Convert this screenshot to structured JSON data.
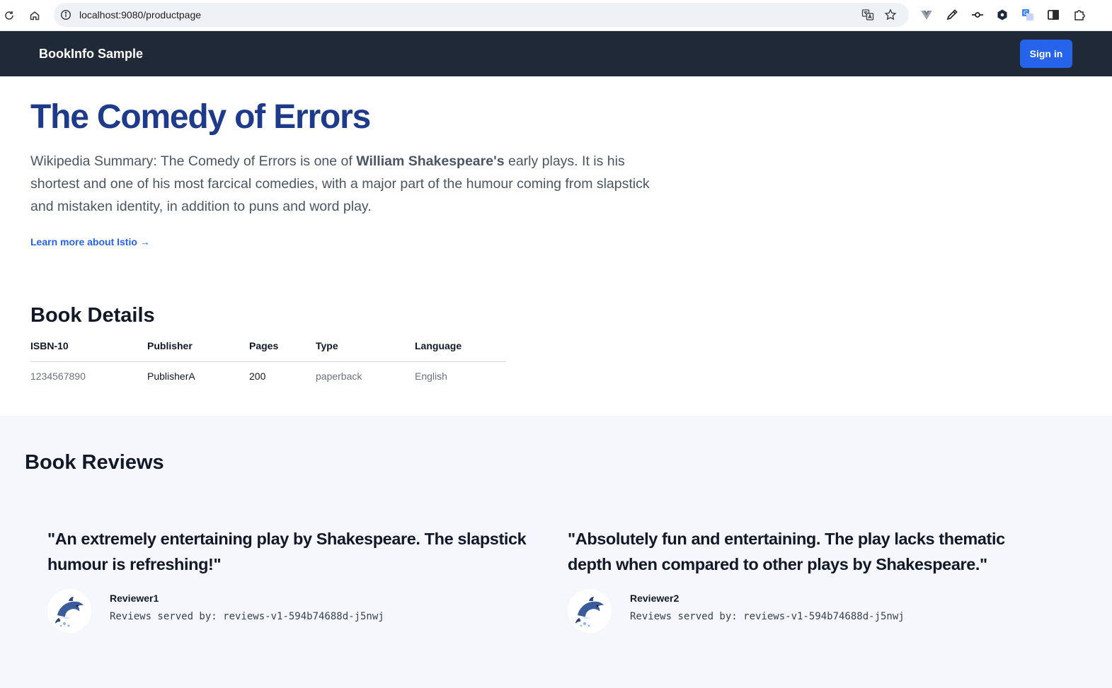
{
  "browser": {
    "url": "localhost:9080/productpage",
    "icons": {
      "reload": "reload-icon",
      "home": "home-icon",
      "info": "info-icon",
      "translate": "translate-icon",
      "bookmark": "star-icon",
      "extensions": [
        "vue-devtools-icon",
        "eyedropper-icon",
        "git-commit-icon",
        "hexagon-extension-icon",
        "google-translate-icon",
        "sidepanel-icon",
        "puzzle-extensions-icon"
      ]
    }
  },
  "navbar": {
    "brand": "BookInfo Sample",
    "signin_label": "Sign in",
    "background": "#1f2937",
    "accent": "#2563eb"
  },
  "hero": {
    "title": "The Comedy of Errors",
    "summary_prefix": "Wikipedia Summary: The Comedy of Errors is one of ",
    "summary_bold": "William Shakespeare's",
    "summary_suffix": " early plays. It is his shortest and one of his most farcical comedies, with a major part of the humour coming from slapstick and mistaken identity, in addition to puns and word play.",
    "learn_more": "Learn more about Istio →",
    "title_color": "#1e3a8a"
  },
  "details": {
    "title": "Book Details",
    "headers": [
      "ISBN-10",
      "Publisher",
      "Pages",
      "Type",
      "Language"
    ],
    "row": [
      "1234567890",
      "PublisherA",
      "200",
      "paperback",
      "English"
    ]
  },
  "reviews": {
    "title": "Book Reviews",
    "items": [
      {
        "text": "\"An extremely entertaining play by Shakespeare. The slapstick humour is refreshing!\"",
        "reviewer": "Reviewer1",
        "served_by": "Reviews served by: reviews-v1-594b74688d-j5nwj",
        "avatar": "dolphin-avatar"
      },
      {
        "text": "\"Absolutely fun and entertaining. The play lacks thematic depth when compared to other plays by Shakespeare.\"",
        "reviewer": "Reviewer2",
        "served_by": "Reviews served by: reviews-v1-594b74688d-j5nwj",
        "avatar": "dolphin-avatar"
      }
    ]
  }
}
